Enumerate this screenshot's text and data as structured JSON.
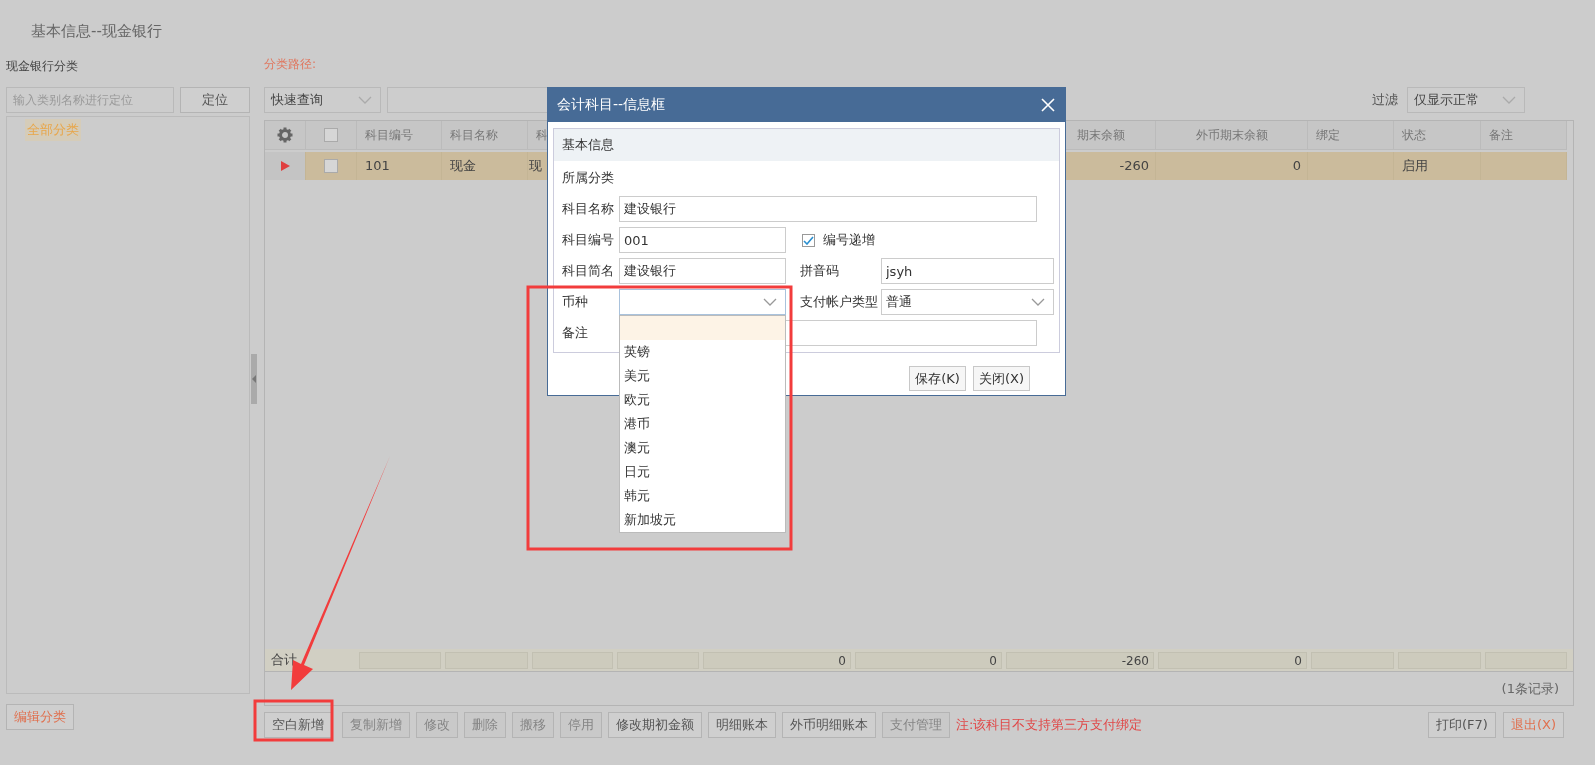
{
  "page_title": "基本信息--现金银行",
  "category_panel": {
    "title": "现金银行分类",
    "search": {
      "placeholder": "输入类别名称进行定位"
    },
    "locate_button": "定位",
    "tree": [
      {
        "label": "全部分类",
        "selected": true
      }
    ],
    "edit_button": "编辑分类"
  },
  "path_label": "分类路径:",
  "quick_query": {
    "value": "快速查询"
  },
  "filter": {
    "label": "过滤",
    "value": "仅显示正常"
  },
  "table": {
    "select_all": {
      "checked": false
    },
    "columns": [
      {
        "kind": "text",
        "label": "科目编号"
      },
      {
        "kind": "text",
        "label": "科目名称"
      },
      {
        "kind": "text",
        "label": "科"
      },
      {
        "kind": "number",
        "label": "期末余额"
      },
      {
        "kind": "number",
        "label": "外币期末余额"
      },
      {
        "kind": "text",
        "label": "绑定"
      },
      {
        "kind": "text",
        "label": "状态"
      },
      {
        "kind": "text",
        "label": "备注"
      }
    ],
    "rows": [
      {
        "selected": true,
        "checked": false,
        "cells": [
          "101",
          "现金",
          "现",
          "-260",
          "0",
          null,
          "启用",
          null
        ]
      }
    ],
    "footer": {
      "label": "合计",
      "cells": [
        null,
        null,
        null,
        null,
        "0",
        "0",
        "-260",
        "0",
        null,
        null,
        null
      ]
    },
    "record_count": "(1条记录)"
  },
  "toolbar_buttons": [
    {
      "label": "空白新增",
      "disabled": false
    },
    {
      "label": "复制新增",
      "disabled": true
    },
    {
      "label": "修改",
      "disabled": true
    },
    {
      "label": "删除",
      "disabled": true
    },
    {
      "label": "搬移",
      "disabled": true
    },
    {
      "label": "停用",
      "disabled": true
    },
    {
      "label": "修改期初金额",
      "disabled": false
    },
    {
      "label": "明细账本",
      "disabled": false
    },
    {
      "label": "外币明细账本",
      "disabled": false
    },
    {
      "label": "支付管理",
      "disabled": true
    }
  ],
  "note": "注:该科目不支持第三方支付绑定",
  "right_buttons": [
    {
      "label": "打印(F7)",
      "kind": "normal"
    },
    {
      "label": "退出(X)",
      "kind": "exit"
    }
  ],
  "dialog": {
    "title": "会计科目--信息框",
    "section": "基本信息",
    "rows": [
      [
        {
          "kind": "static",
          "label": "所属分类"
        }
      ],
      [
        {
          "kind": "text",
          "label": "科目名称",
          "value": "建设银行"
        }
      ],
      [
        {
          "kind": "text",
          "label": "科目编号",
          "value": "001"
        },
        {
          "kind": "checkbox",
          "label": "编号递增",
          "checked": true
        }
      ],
      [
        {
          "kind": "text",
          "label": "科目简名",
          "value": "建设银行"
        },
        {
          "kind": "text",
          "label": "拼音码",
          "value": "jsyh"
        }
      ],
      [
        {
          "kind": "select",
          "label": "币种",
          "expanded": true
        },
        {
          "kind": "select",
          "label": "支付帐户类型",
          "value": "普通",
          "expanded": false
        }
      ],
      [
        {
          "kind": "text",
          "label": "备注"
        }
      ]
    ],
    "open_dropdown": {
      "options": [
        {
          "selected": true
        },
        {
          "label": "英镑",
          "selected": false
        },
        {
          "label": "美元",
          "selected": false
        },
        {
          "label": "欧元",
          "selected": false
        },
        {
          "label": "港币",
          "selected": false
        },
        {
          "label": "澳元",
          "selected": false
        },
        {
          "label": "日元",
          "selected": false
        },
        {
          "label": "韩元",
          "selected": false
        },
        {
          "label": "新加坡元",
          "selected": false
        }
      ]
    },
    "buttons": [
      "保存(K)",
      "关闭(X)"
    ]
  }
}
